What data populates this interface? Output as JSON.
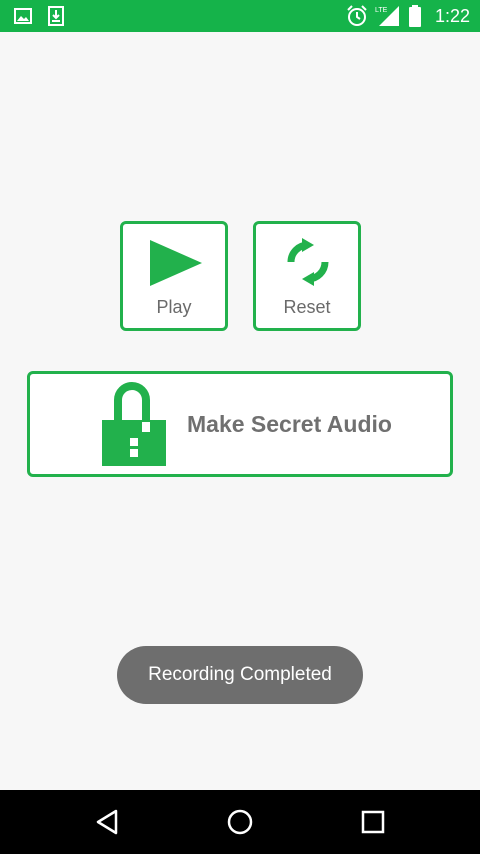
{
  "status_bar": {
    "time": "1:22",
    "network": "LTE",
    "icons": [
      "gallery-icon",
      "download-icon",
      "alarm-icon",
      "signal-icon",
      "battery-icon"
    ],
    "color": "#15b34a"
  },
  "buttons": {
    "play_label": "Play",
    "reset_label": "Reset",
    "secret_label": "Make Secret Audio"
  },
  "toast": {
    "message": "Recording Completed"
  },
  "navigation": {
    "icons": [
      "back-icon",
      "home-icon",
      "recents-icon"
    ]
  },
  "colors": {
    "accent": "#22b14c",
    "toast_bg": "#6e6e6e",
    "label_gray": "#6a6a6a"
  }
}
